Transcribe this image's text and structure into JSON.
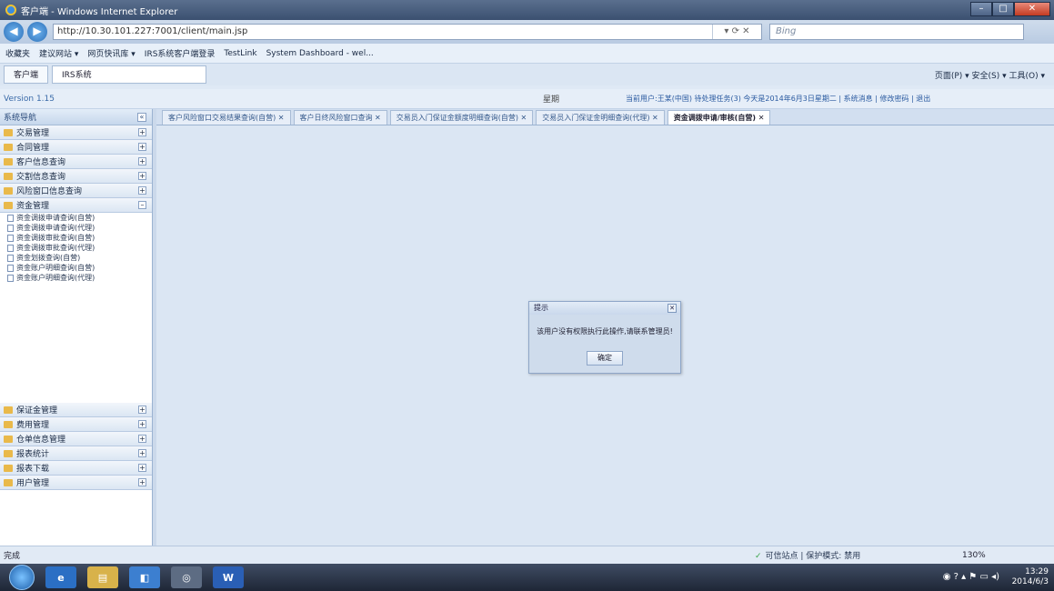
{
  "window": {
    "title": "客户端 - Windows Internet Explorer"
  },
  "address": {
    "url": "http://10.30.101.227:7001/client/main.jsp",
    "search_placeholder": "Bing"
  },
  "favorites": {
    "label": "收藏夹",
    "items": [
      "建议网站 ▾",
      "网页快讯库 ▾",
      "IRS系统客户端登录",
      "TestLink",
      "System Dashboard - wel..."
    ]
  },
  "tabs": {
    "tab1": "客户端",
    "tab2": "IRS系统",
    "tools": "页面(P) ▾  安全(S) ▾  工具(O) ▾"
  },
  "app": {
    "version": "Version 1.15",
    "date": "星期",
    "user_info": "当前用户:王某(中国)  待处理任务(3)  今天是2014年6月3日星期二  |  系统消息  |  修改密码  |  退出"
  },
  "sidebar": {
    "title": "系统导航",
    "top_menus": [
      "交易管理",
      "合同管理",
      "客户信息查询",
      "交割信息查询",
      "风险窗口信息查询",
      "资金管理"
    ],
    "submenu": [
      "资金调拨申请查询(自营)",
      "资金调拨申请查询(代理)",
      "资金调拨审批查询(自营)",
      "资金调拨审批查询(代理)",
      "资金划拨查询(自营)",
      "资金账户明细查询(自营)",
      "资金账户明细查询(代理)"
    ],
    "bottom_menus": [
      "保证金管理",
      "费用管理",
      "仓单信息管理",
      "报表统计",
      "报表下载",
      "用户管理"
    ]
  },
  "main_tabs": [
    "客户风险窗口交易结果查询(自营)",
    "客户日终风险窗口查询",
    "交易员入门保证金额度明细查询(自营)",
    "交易员入门保证金明细查询(代理)",
    "资金调拨申请/审核(自营)"
  ],
  "dialog": {
    "title": "提示",
    "message": "该用户没有权限执行此操作,请联系管理员!",
    "ok": "确定"
  },
  "status": {
    "done": "完成",
    "zone": "可信站点 | 保护模式: 禁用",
    "zoom": "130%"
  },
  "taskbar": {
    "time": "13:29",
    "date": "2014/6/3"
  }
}
